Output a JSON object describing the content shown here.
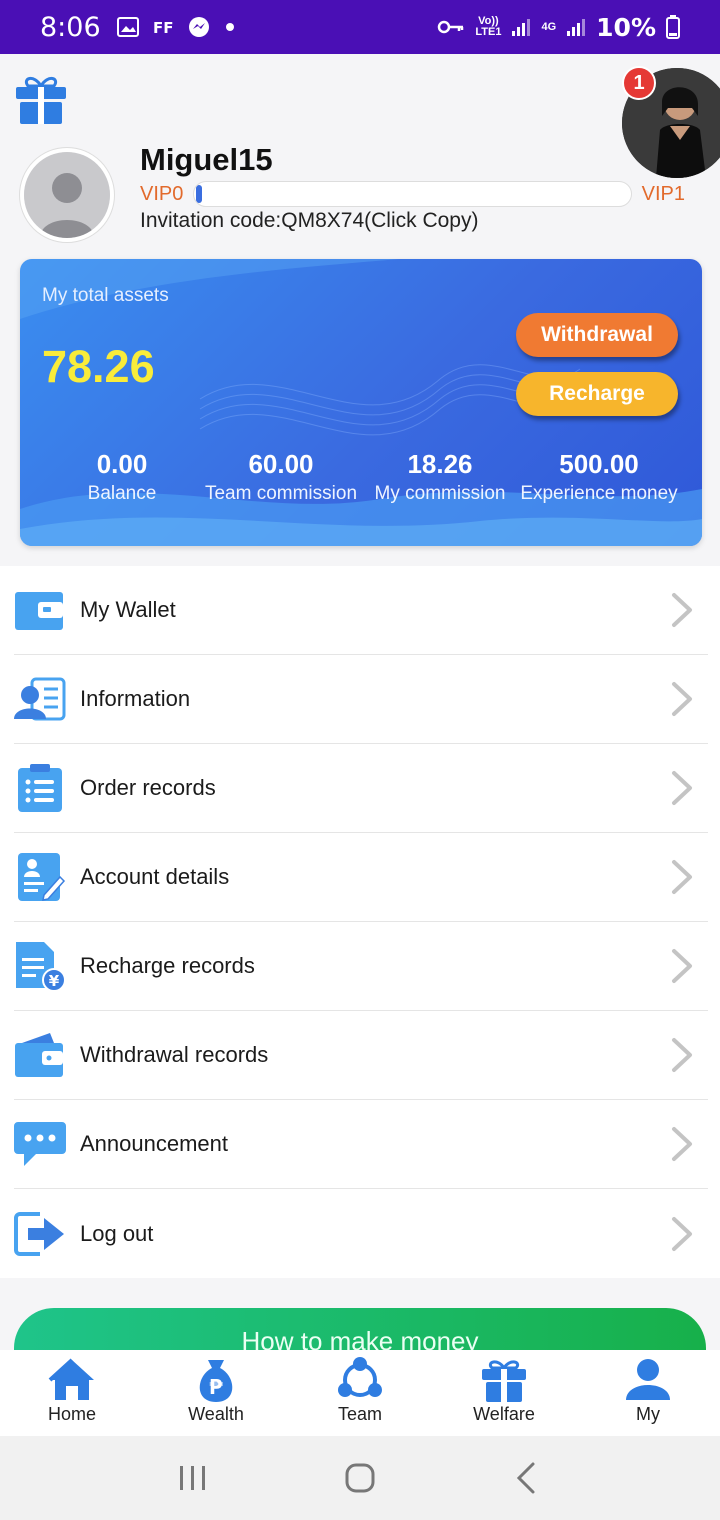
{
  "status_bar": {
    "time": "8:06",
    "lte_top": "Vo))",
    "lte_bottom": "LTE1",
    "net": "4G",
    "battery": "10%"
  },
  "profile": {
    "username": "Miguel15",
    "vip_current": "VIP0",
    "vip_next": "VIP1",
    "vip_progress": 0.02,
    "invitation": "Invitation code:QM8X74(Click Copy)",
    "notification_count": "1"
  },
  "assets": {
    "title": "My total assets",
    "total": "78.26",
    "withdraw_label": "Withdrawal",
    "recharge_label": "Recharge",
    "stats": [
      {
        "value": "0.00",
        "label": "Balance"
      },
      {
        "value": "60.00",
        "label": "Team commission"
      },
      {
        "value": "18.26",
        "label": "My commission"
      },
      {
        "value": "500.00",
        "label": "Experience money"
      }
    ]
  },
  "menu": {
    "items": [
      {
        "label": "My Wallet",
        "icon": "wallet-icon"
      },
      {
        "label": "Information",
        "icon": "user-card-icon"
      },
      {
        "label": "Order records",
        "icon": "clipboard-list-icon"
      },
      {
        "label": "Account details",
        "icon": "document-edit-icon"
      },
      {
        "label": "Recharge records",
        "icon": "yen-document-icon"
      },
      {
        "label": "Withdrawal records",
        "icon": "wallet-card-icon"
      },
      {
        "label": "Announcement",
        "icon": "chat-bubble-icon"
      },
      {
        "label": "Log out",
        "icon": "logout-icon"
      }
    ]
  },
  "banner": {
    "label": "How to make money"
  },
  "tabbar": {
    "items": [
      {
        "label": "Home",
        "icon": "home-icon"
      },
      {
        "label": "Wealth",
        "icon": "money-bag-icon"
      },
      {
        "label": "Team",
        "icon": "team-icon"
      },
      {
        "label": "Welfare",
        "icon": "gift-icon"
      },
      {
        "label": "My",
        "icon": "person-icon"
      }
    ]
  },
  "colors": {
    "status_bar": "#4a0fb5",
    "accent_blue": "#3a6ae0",
    "total_yellow": "#f9ec3a",
    "withdraw_orange": "#f07a32",
    "recharge_yellow": "#f7b52c",
    "vip_orange": "#e26a2c",
    "banner_green": "#17b04a"
  }
}
